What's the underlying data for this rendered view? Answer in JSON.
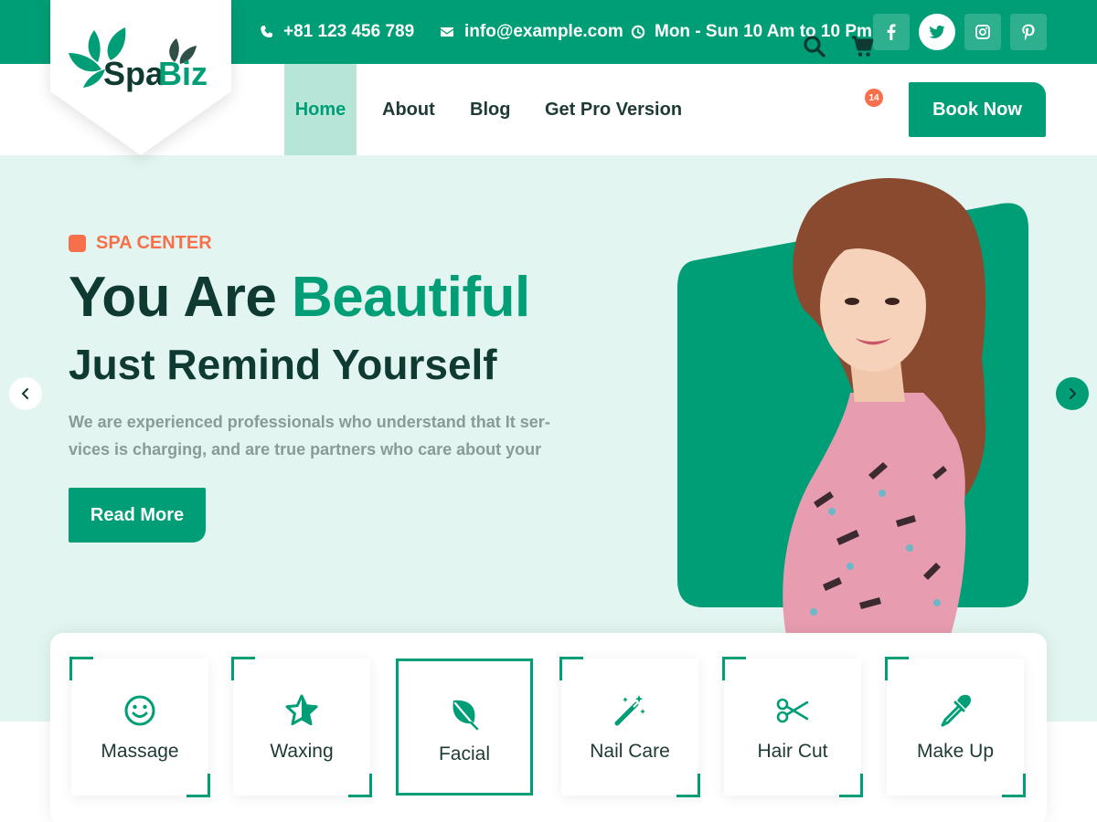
{
  "brand": {
    "name": "SpaBiz",
    "name_part1": "Spa",
    "name_part2": "Biz"
  },
  "topbar": {
    "phone": "+81 123 456 789",
    "email": "info@example.com",
    "hours": "Mon - Sun 10 Am to 10 Pm",
    "social": [
      "facebook-icon",
      "twitter-icon",
      "instagram-icon",
      "pinterest-icon"
    ]
  },
  "nav": {
    "items": [
      {
        "label": "Home",
        "active": true
      },
      {
        "label": "About",
        "active": false
      },
      {
        "label": "Blog",
        "active": false
      },
      {
        "label": "Get Pro Version",
        "active": false
      }
    ],
    "cart_count": "14",
    "book_label": "Book Now"
  },
  "hero": {
    "tag": "SPA CENTER",
    "title_part1": "You Are ",
    "title_accent": "Beautiful",
    "subtitle": "Just Remind Yourself",
    "description": "We are experienced professionals who understand that It ser-vices is charging, and are true partners who care about your",
    "read_more": "Read More"
  },
  "services": [
    {
      "label": "Massage",
      "icon": "smile-icon"
    },
    {
      "label": "Waxing",
      "icon": "star-icon"
    },
    {
      "label": "Facial",
      "icon": "leaf-icon"
    },
    {
      "label": "Nail Care",
      "icon": "magic-wand-icon"
    },
    {
      "label": "Hair Cut",
      "icon": "scissors-icon"
    },
    {
      "label": "Make Up",
      "icon": "eyedropper-icon"
    }
  ],
  "colors": {
    "primary": "#009e76",
    "primary_light": "#e2f5f0",
    "nav_active_bg": "#b7e6d8",
    "accent": "#f7704b",
    "heading": "#0f3a31",
    "muted": "#8a9b97"
  }
}
